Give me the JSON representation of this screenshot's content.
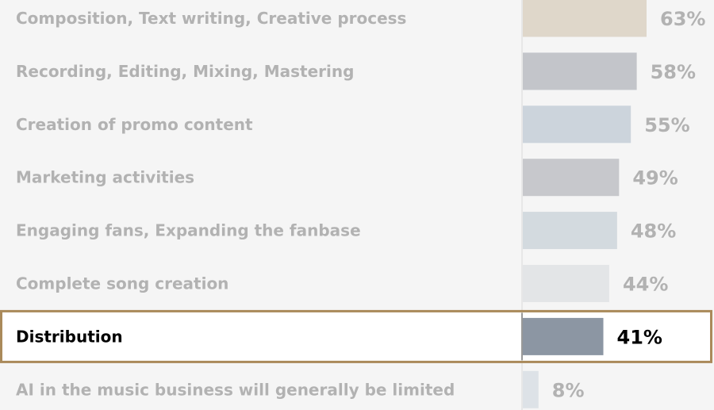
{
  "chart_data": {
    "type": "bar",
    "orientation": "horizontal",
    "categories": [
      "Composition, Text writing, Creative process",
      "Recording, Editing, Mixing, Mastering",
      "Creation of promo content",
      "Marketing activities",
      "Engaging fans, Expanding the fanbase",
      "Complete song creation",
      "Distribution",
      "AI in the music business will generally be limited"
    ],
    "values": [
      63,
      58,
      55,
      49,
      48,
      44,
      41,
      8
    ],
    "value_labels": [
      "63%",
      "58%",
      "55%",
      "49%",
      "48%",
      "44%",
      "41%",
      "8%"
    ],
    "bar_colors": [
      "#dfd7ca",
      "#c3c5ca",
      "#ccd4dc",
      "#c7c8cc",
      "#d3dadf",
      "#e3e5e7",
      "#8c96a3",
      "#dde2e7"
    ],
    "highlight": "Distribution",
    "highlight_border_color": "#aa8a5a",
    "muted_text_color": "#b2b2b2",
    "highlight_text_color": "#000000",
    "xlim": [
      0,
      63
    ],
    "title": "",
    "xlabel": "",
    "ylabel": ""
  }
}
